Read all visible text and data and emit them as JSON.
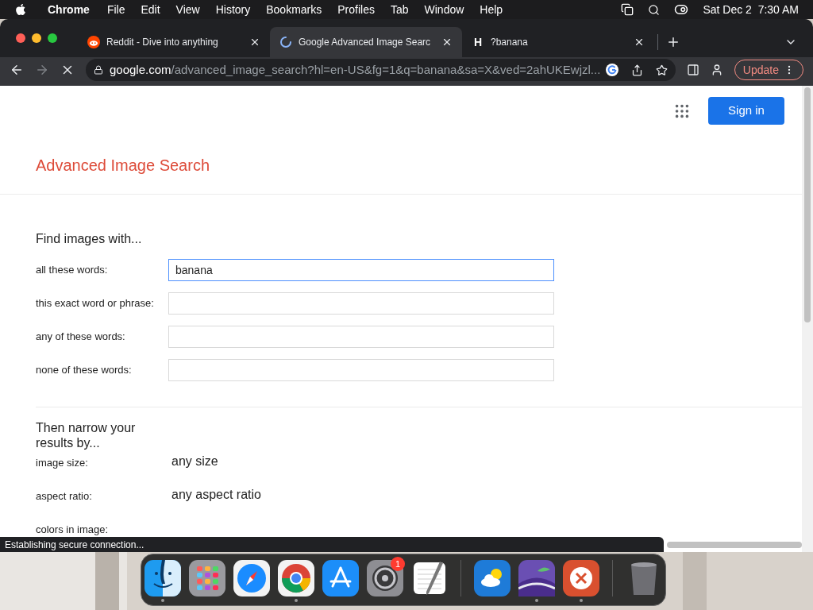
{
  "menubar": {
    "app": "Chrome",
    "menus": [
      "File",
      "Edit",
      "View",
      "History",
      "Bookmarks",
      "Profiles",
      "Tab",
      "Window",
      "Help"
    ],
    "clock": "Sat Dec 2  7:30 AM"
  },
  "tabs": [
    {
      "title": "Reddit - Dive into anything",
      "selected": false,
      "kind": "reddit"
    },
    {
      "title": "Google Advanced Image Searc",
      "selected": true,
      "kind": "spinner"
    },
    {
      "title": "?banana",
      "selected": false,
      "kind": "letter",
      "letter": "H"
    }
  ],
  "toolbar": {
    "forward_enabled": false,
    "url_host": "google.com",
    "url_path": "/advanced_image_search?hl=en-US&fg=1&q=banana&sa=X&ved=2ahUKEwjzl...",
    "update": "Update"
  },
  "page": {
    "sign_in": "Sign in",
    "title": "Advanced Image Search",
    "section_1": "Find images with...",
    "fields": [
      {
        "label": "all these words:",
        "value": "banana",
        "focused": true
      },
      {
        "label": "this exact word or phrase:",
        "focused": false
      },
      {
        "label": "any of these words:",
        "focused": false
      },
      {
        "label": "none of these words:",
        "focused": false
      }
    ],
    "section_2": "Then narrow your results by...",
    "options": [
      {
        "label": "image size:",
        "value": "any size"
      },
      {
        "label": "aspect ratio:",
        "value": "any aspect ratio"
      },
      {
        "label": "colors in image:"
      }
    ]
  },
  "status": "Establishing secure connection...",
  "dock": [
    {
      "kind": "finder",
      "running": true
    },
    {
      "kind": "launchpad",
      "running": false
    },
    {
      "kind": "safari",
      "running": false
    },
    {
      "kind": "chrome",
      "running": true
    },
    {
      "kind": "appstore",
      "running": false
    },
    {
      "kind": "settings",
      "running": false,
      "badge": "1"
    },
    {
      "kind": "textedit",
      "running": false
    },
    {
      "kind": "separator"
    },
    {
      "kind": "weather",
      "running": false
    },
    {
      "kind": "purple",
      "running": true
    },
    {
      "kind": "remote",
      "running": true
    },
    {
      "kind": "separator"
    },
    {
      "kind": "trash",
      "running": false
    }
  ]
}
